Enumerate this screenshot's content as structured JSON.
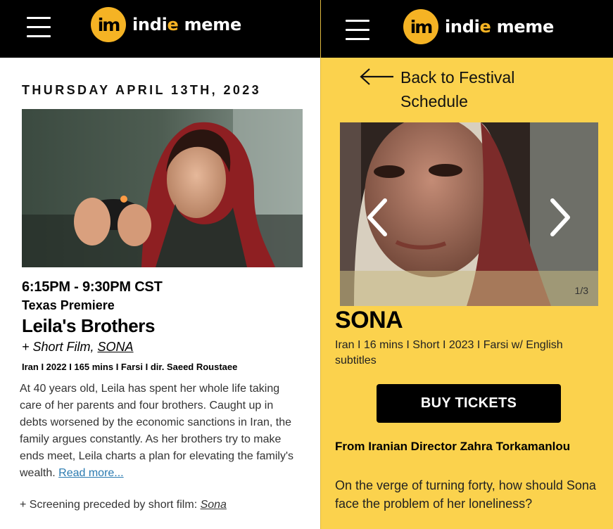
{
  "left": {
    "logo": {
      "badge": "im",
      "text_pre": "indi",
      "text_accent": "e",
      "text_post": " meme"
    },
    "date_heading": "THURSDAY APRIL 13TH, 2023",
    "time": "6:15PM - 9:30PM CST",
    "premiere": "Texas Premiere",
    "film_title": "Leila's Brothers",
    "short_film_prefix": "+ Short Film, ",
    "short_film_link": "SONA",
    "meta": "Iran I 2022 I 165 mins I Farsi I dir. Saeed Roustaee",
    "synopsis": "At 40 years old, Leila has spent her whole life taking care of her parents and four brothers. Caught up in debts worsened by the economic sanctions in Iran, the family argues constantly. As her brothers try to make ends meet, Leila charts a plan for elevating the family's wealth. ",
    "read_more": "Read more...",
    "screening_note_prefix": "+ Screening preceded by short film: ",
    "screening_note_link": "Sona"
  },
  "right": {
    "logo": {
      "badge": "im",
      "text_pre": "indi",
      "text_accent": "e",
      "text_post": " meme"
    },
    "back_link": "Back to Festival Schedule",
    "carousel_count": "1/3",
    "title": "SONA",
    "meta": "Iran  I 16  mins  I Short I 2023 I Farsi w/ English subtitles",
    "buy_button": "BUY TICKETS",
    "director": "From Iranian Director Zahra Torkamanlou",
    "description": "On the verge of turning forty, how should Sona face the problem of her loneliness?"
  },
  "colors": {
    "brand_yellow": "#f5b324",
    "panel_yellow": "#fbd24d",
    "header_black": "#000000",
    "link_blue": "#2a7ab0"
  },
  "icons": [
    "menu-icon",
    "arrow-left-icon",
    "chevron-left-icon",
    "chevron-right-icon"
  ]
}
